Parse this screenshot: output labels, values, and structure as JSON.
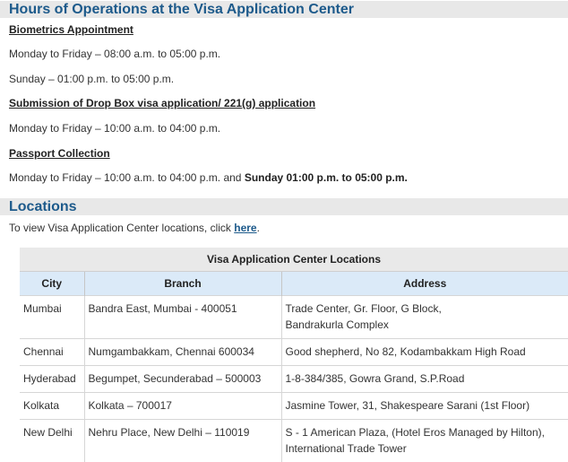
{
  "hours": {
    "heading": "Hours of Operations at the Visa Application Center",
    "biometrics_title": "Biometrics Appointment",
    "biometrics_weekday": "Monday to Friday – 08:00 a.m. to 05:00 p.m.",
    "biometrics_sunday": "Sunday – 01:00 p.m. to 05:00 p.m.",
    "dropbox_title": "Submission of Drop Box visa application/ 221(g) application",
    "dropbox_weekday": "Monday to Friday – 10:00 a.m. to 04:00 p.m.",
    "passport_title": "Passport Collection",
    "passport_weekday": "Monday to Friday – 10:00 a.m. to 04:00 p.m. and ",
    "passport_sunday": "Sunday 01:00 p.m. to 05:00 p.m."
  },
  "locations": {
    "heading": "Locations",
    "intro_text": "To view Visa Application Center locations, click ",
    "intro_link": "here",
    "intro_end": ".",
    "table": {
      "caption": "Visa Application Center Locations",
      "headers": [
        "City",
        "Branch",
        "Address"
      ],
      "rows": [
        {
          "city": "Mumbai",
          "branch": "Bandra East, Mumbai - 400051",
          "address1": "Trade Center, Gr. Floor, G Block,",
          "address2": "Bandrakurla Complex"
        },
        {
          "city": "Chennai",
          "branch": "Numgambakkam, Chennai 600034",
          "address1": "Good shepherd, No 82, Kodambakkam High Road",
          "address2": ""
        },
        {
          "city": "Hyderabad",
          "branch": "Begumpet, Secunderabad – 500003",
          "address1": "1-8-384/385, Gowra Grand, S.P.Road",
          "address2": ""
        },
        {
          "city": "Kolkata",
          "branch": "Kolkata – 700017",
          "address1": "Jasmine Tower, 31, Shakespeare Sarani (1st Floor)",
          "address2": ""
        },
        {
          "city": "New Delhi",
          "branch": "Nehru Place, New Delhi – 110019",
          "address1": "S - 1 American Plaza, (Hotel Eros Managed by Hilton),",
          "address2": "International Trade Tower"
        }
      ]
    }
  }
}
